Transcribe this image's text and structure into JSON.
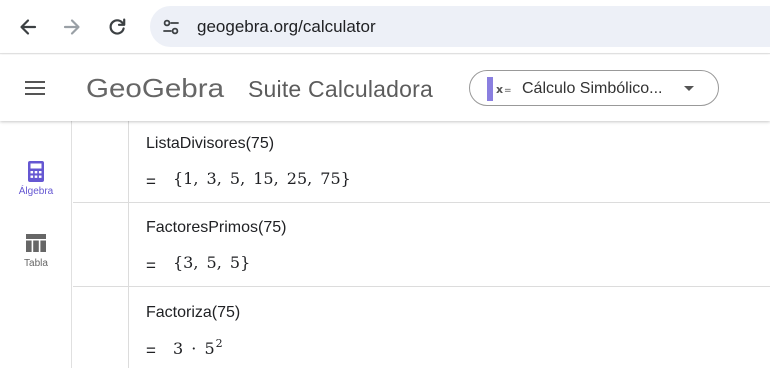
{
  "browser": {
    "url": "geogebra.org/calculator",
    "back_icon": "arrow-left-icon",
    "forward_icon": "arrow-right-icon",
    "reload_icon": "reload-icon",
    "site_info_icon": "tune-icon"
  },
  "header": {
    "menu_icon": "hamburger-menu-icon",
    "brand": "GeoGebra",
    "title": "Suite Calculadora",
    "app_selector": {
      "label": "Cálculo Simbólico...",
      "icon": "cas-icon",
      "caret_icon": "caret-down-icon"
    }
  },
  "sidebar": {
    "tabs": [
      {
        "label": "Álgebra",
        "icon": "calculator-icon",
        "active": true
      },
      {
        "label": "Tabla",
        "icon": "table-icon",
        "active": false
      }
    ]
  },
  "algebra": {
    "eq_sign": "=",
    "rows": [
      {
        "input": "ListaDivisores(75)",
        "output": "{1, 3, 5, 15, 25, 75}"
      },
      {
        "input": "FactoresPrimos(75)",
        "output": "{3, 5, 5}"
      },
      {
        "input": "Factoriza(75)",
        "output_base": "3 · 5",
        "output_exponent": "2"
      }
    ]
  },
  "colors": {
    "accent": "#6557d2",
    "omnibox_bg": "#edf0f7",
    "inactive_tab": "#666666"
  }
}
